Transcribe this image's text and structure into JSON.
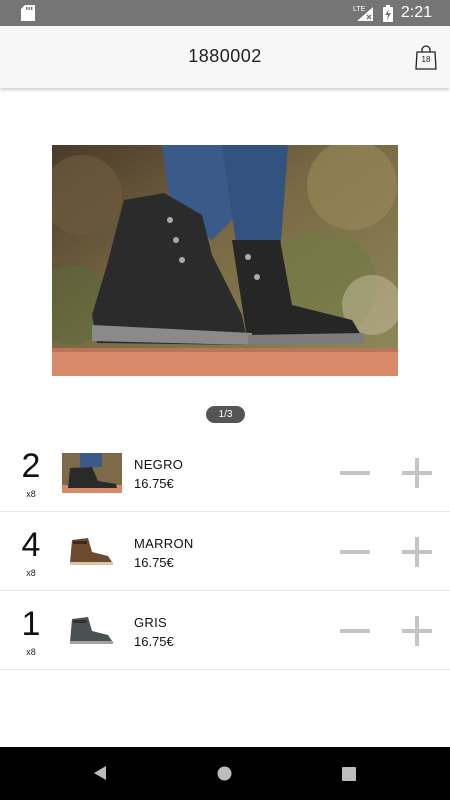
{
  "status_bar": {
    "time": "2:21",
    "network": "LTE",
    "icons": [
      "sd-card-icon",
      "signal-icon",
      "battery-charging-icon"
    ]
  },
  "header": {
    "title": "1880002",
    "cart_count": "18",
    "cart_icon": "shopping-bag-icon"
  },
  "gallery": {
    "pager": "1/3"
  },
  "variants": [
    {
      "qty": "2",
      "multiplier": "x8",
      "name": "NEGRO",
      "price": "16.75€",
      "thumb_color": "#2b2b2b"
    },
    {
      "qty": "4",
      "multiplier": "x8",
      "name": "MARRON",
      "price": "16.75€",
      "thumb_color": "#6b4a30"
    },
    {
      "qty": "1",
      "multiplier": "x8",
      "name": "GRIS",
      "price": "16.75€",
      "thumb_color": "#4b5052"
    }
  ],
  "nav": {
    "icons": [
      "back-icon",
      "home-icon",
      "recents-icon"
    ]
  }
}
